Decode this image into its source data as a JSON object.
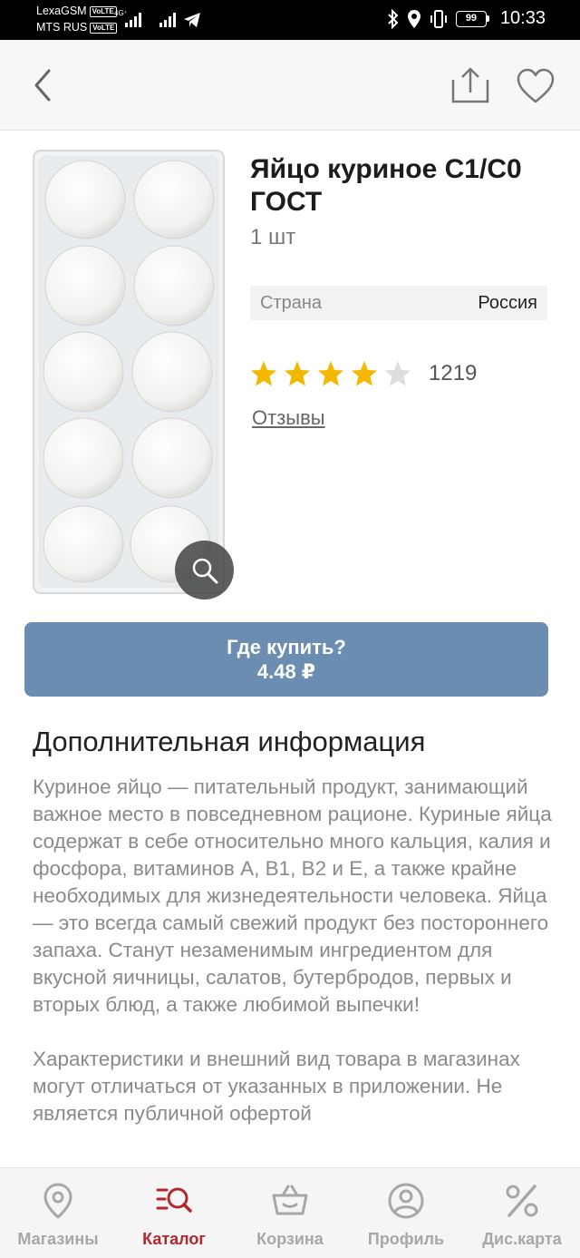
{
  "status_bar": {
    "carrier1": "LexaGSM",
    "carrier2": "MTS RUS",
    "volte": "VoLTE",
    "net_type": "4G⁺",
    "battery": "99",
    "time": "10:33"
  },
  "product": {
    "title": "Яйцо куриное С1/С0 ГОСТ",
    "unit": "1 шт",
    "country_label": "Страна",
    "country_value": "Россия",
    "rating": 4,
    "rating_max": 5,
    "rating_count": "1219",
    "reviews_label": "Отзывы"
  },
  "buy": {
    "label": "Где купить?",
    "price": "4.48 ₽"
  },
  "info": {
    "heading": "Дополнительная информация",
    "paragraph1": "Куриное яйцо — питательный продукт, занимающий важное место в повседневном рационе. Куриные яйца содержат в себе относительно много кальция, калия и фосфора, витаминов А, В1, В2 и Е, а также крайне необходимых для жизнедеятельности человека. Яйца — это всегда самый свежий продукт без постороннего запаха. Станут незаменимым ингредиентом для вкусной яичницы, салатов, бутербродов, первых и вторых блюд, а также любимой выпечки!",
    "paragraph2": "Характеристики и внешний вид товара в магазинах могут отличаться от указанных в приложении. Не является публичной офертой"
  },
  "bottom_nav": {
    "items": [
      {
        "label": "Магазины",
        "icon": "map-pin-icon"
      },
      {
        "label": "Каталог",
        "icon": "catalog-search-icon"
      },
      {
        "label": "Корзина",
        "icon": "basket-icon"
      },
      {
        "label": "Профиль",
        "icon": "profile-icon"
      },
      {
        "label": "Дис.карта",
        "icon": "percent-icon"
      }
    ],
    "active_index": 1
  },
  "colors": {
    "accent": "#b3262f",
    "buy_button": "#6a8db1",
    "star_filled": "#f5b800",
    "star_empty": "#dddddd"
  }
}
